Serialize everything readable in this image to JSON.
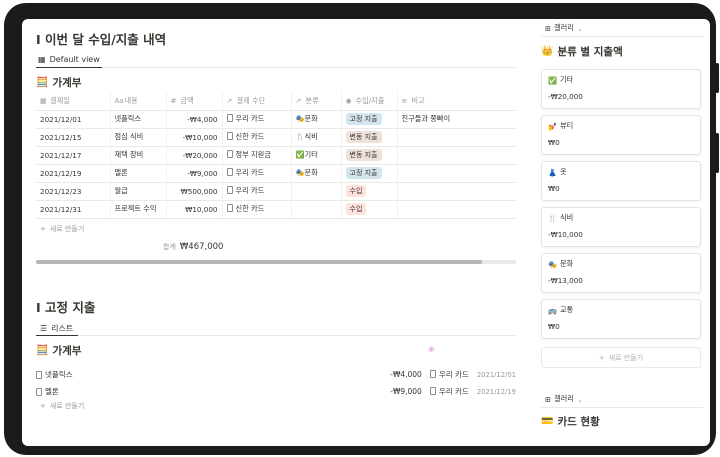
{
  "section1": {
    "title": "I 이번 달 수입/지출 내역",
    "view_tab": "Default view",
    "db_emoji": "🧮",
    "db_title": "가계부",
    "columns": [
      {
        "icon": "calendar-icon",
        "glyph": "▦",
        "label": "결제일"
      },
      {
        "icon": "text-icon",
        "glyph": "Aa",
        "label": "내용"
      },
      {
        "icon": "number-icon",
        "glyph": "#",
        "label": "금액"
      },
      {
        "icon": "relation-icon",
        "glyph": "↗",
        "label": "결제 수단"
      },
      {
        "icon": "relation-icon",
        "glyph": "↗",
        "label": "분류"
      },
      {
        "icon": "select-icon",
        "glyph": "◉",
        "label": "수입/지출"
      },
      {
        "icon": "lines-icon",
        "glyph": "≡",
        "label": "비고"
      }
    ],
    "rows": [
      {
        "date": "2021/12/01",
        "item": "넷플릭스",
        "amount": "-₩4,000",
        "method": "우리 카드",
        "cat_emoji": "🎭",
        "category": "문화",
        "type": "고정 지출",
        "type_color": "#d3e5ef",
        "note": "친구들과 쫑빠이"
      },
      {
        "date": "2021/12/15",
        "item": "점심 식비",
        "amount": "-₩10,000",
        "method": "신한 카드",
        "cat_emoji": "🍴",
        "category": "식비",
        "type": "변동 지출",
        "type_color": "#eee0da",
        "note": ""
      },
      {
        "date": "2021/12/17",
        "item": "재택 장비",
        "amount": "-₩20,000",
        "method": "정부 지원금",
        "cat_emoji": "✅",
        "category": "기타",
        "type": "변동 지출",
        "type_color": "#eee0da",
        "note": ""
      },
      {
        "date": "2021/12/19",
        "item": "멜론",
        "amount": "-₩9,000",
        "method": "우리 카드",
        "cat_emoji": "🎭",
        "category": "문화",
        "type": "고정 지출",
        "type_color": "#d3e5ef",
        "note": ""
      },
      {
        "date": "2021/12/23",
        "item": "월급",
        "amount": "₩500,000",
        "method": "우리 카드",
        "cat_emoji": "",
        "category": "",
        "type": "수입",
        "type_color": "#ffe2dd",
        "note": ""
      },
      {
        "date": "2021/12/31",
        "item": "프로젝트 수익",
        "amount": "₩10,000",
        "method": "신한 카드",
        "cat_emoji": "",
        "category": "",
        "type": "수입",
        "type_color": "#ffe2dd",
        "note": ""
      }
    ],
    "new_label": "새로 만들기",
    "sum_label": "합계",
    "sum_value": "₩467,000",
    "scroll_fraction": 0.93
  },
  "section2": {
    "title": "I 고정 지출",
    "view_tab": "리스트",
    "db_emoji": "🧮",
    "db_title": "가계부",
    "rows": [
      {
        "item": "넷플릭스",
        "amount": "-₩4,000",
        "method": "우리 카드",
        "date": "2021/12/01"
      },
      {
        "item": "멜론",
        "amount": "-₩9,000",
        "method": "우리 카드",
        "date": "2021/12/19"
      }
    ],
    "new_label": "새로 만들기"
  },
  "sidebar": {
    "gallery_label": "갤러리",
    "heading_emoji": "👑",
    "heading": "분류 별 지출액",
    "cards": [
      {
        "emoji": "✅",
        "name": "기타",
        "value": "-₩20,000"
      },
      {
        "emoji": "💅",
        "name": "뷰티",
        "value": "₩0"
      },
      {
        "emoji": "👗",
        "name": "옷",
        "value": "₩0"
      },
      {
        "emoji": "🍴",
        "name": "식비",
        "value": "-₩10,000"
      },
      {
        "emoji": "🎭",
        "name": "문화",
        "value": "-₩13,000"
      },
      {
        "emoji": "🚌",
        "name": "교통",
        "value": "₩0"
      }
    ],
    "new_label": "새로 만들기",
    "gallery2_label": "갤러리",
    "card_heading_emoji": "💳",
    "card_heading": "카드 현황"
  }
}
